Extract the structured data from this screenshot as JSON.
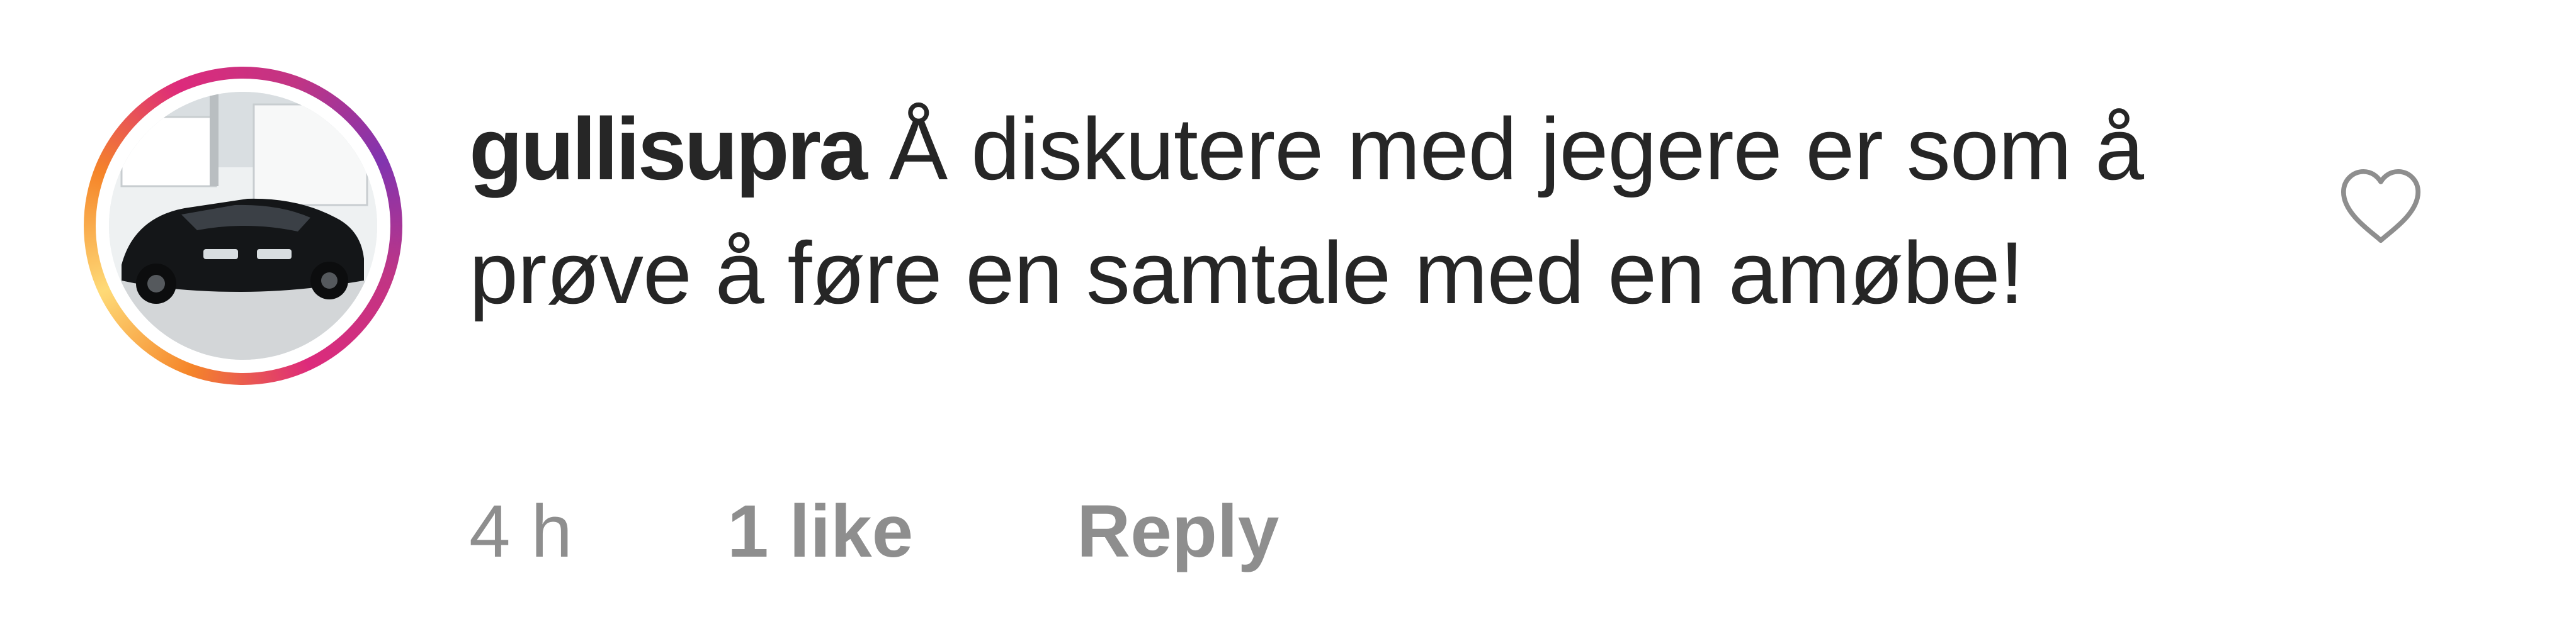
{
  "comment": {
    "username": "gullisupra",
    "text": "Å diskutere med jegere er som å prøve å føre en samtale med en amøbe!",
    "time": "4 h",
    "likes": "1 like",
    "reply_label": "Reply"
  },
  "icons": {
    "avatar": "profile-photo-black-sports-car",
    "like": "heart-outline-icon"
  },
  "colors": {
    "text": "#262626",
    "meta": "#8e8e8e",
    "story_ring": [
      "#f58529",
      "#dd2a7b",
      "#8134af"
    ]
  }
}
